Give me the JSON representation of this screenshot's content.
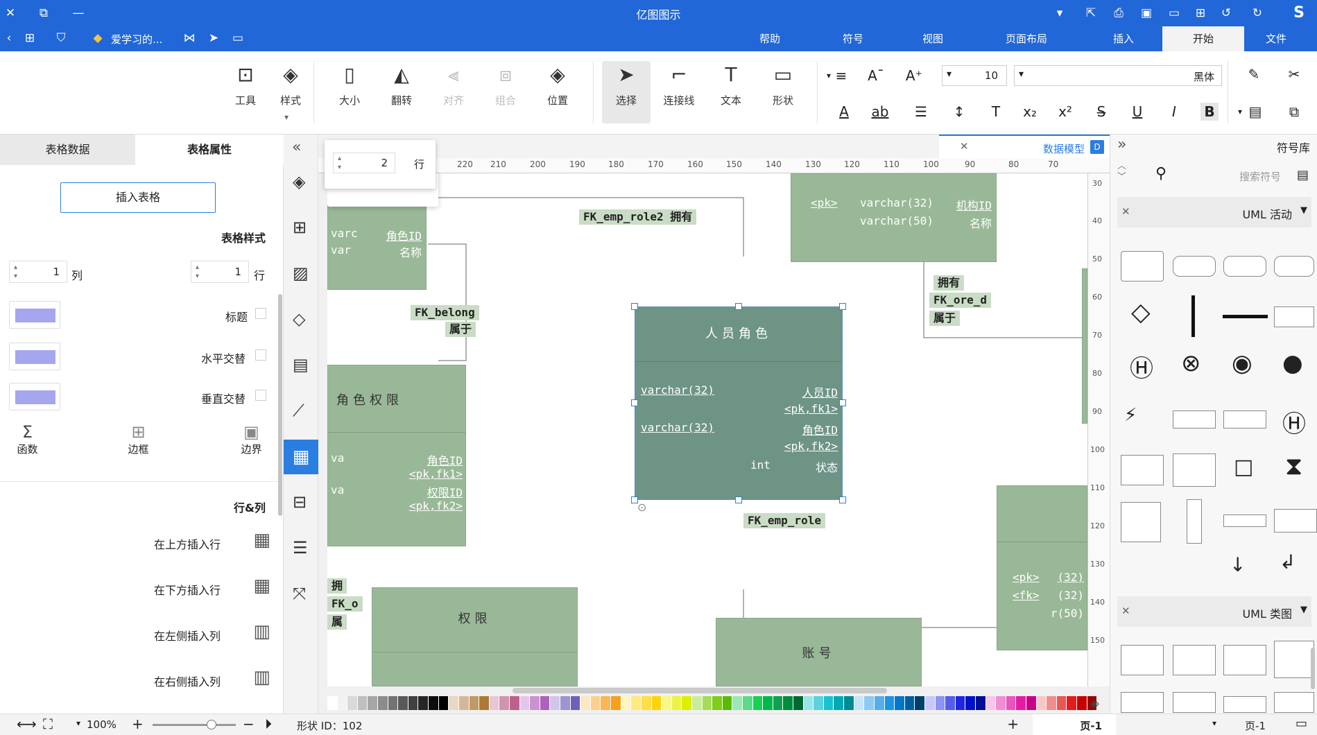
{
  "app": {
    "title": "亿图图示"
  },
  "menu_tabs": [
    "文件",
    "开始",
    "插入",
    "页面布局",
    "视图",
    "符号",
    "帮助"
  ],
  "quick": {
    "user": "爱学习的..."
  },
  "ribbon": {
    "font_name": "黑体",
    "font_size": "10",
    "tools": {
      "shape": "形状",
      "text": "文本",
      "connector": "连接线",
      "select": "选择",
      "position": "位置",
      "group": "组合",
      "align": "对齐",
      "rotate": "翻转",
      "size": "大小",
      "style": "样式",
      "tools": "工具"
    }
  },
  "left_panel": {
    "tabs": [
      "表格属性",
      "表格数据"
    ],
    "insert_table": "插入表格",
    "table_style_title": "表格样式",
    "row_label": "行",
    "row_value": "1",
    "col_label": "列",
    "col_value": "1",
    "checks": [
      "标题",
      "水平交替",
      "垂直交替"
    ],
    "borders": [
      "边界",
      "边框",
      "函数"
    ],
    "rows_cols_title": "行&列",
    "row_col_actions": [
      "在上方插入行",
      "在下方插入行",
      "在左侧插入列",
      "在右侧插入列"
    ]
  },
  "canvas": {
    "doc_tab": "数据模型",
    "float_row_label": "行",
    "float_row_value": "2",
    "ruler": [
      "220",
      "210",
      "200",
      "190",
      "180",
      "170",
      "160",
      "150",
      "140",
      "130",
      "120",
      "110",
      "100",
      "90",
      "80",
      "70"
    ],
    "vruler": [
      "30",
      "40",
      "50",
      "60",
      "70",
      "80",
      "90",
      "100",
      "110",
      "120",
      "130",
      "140",
      "150"
    ],
    "entities": {
      "center_title": "人员角色",
      "center_fields": [
        [
          "人员ID",
          "varchar(32)"
        ],
        [
          "<pk,fk1>",
          ""
        ],
        [
          "角色ID",
          "varchar(32)"
        ],
        [
          "<pk,fk2>",
          ""
        ],
        [
          "状态",
          "int"
        ]
      ],
      "org_fields": [
        [
          "机构ID",
          "varchar(32)",
          "<pk>"
        ],
        [
          "名称",
          "varchar(50)",
          ""
        ]
      ],
      "topleft_fields": [
        [
          "角色ID",
          "varc"
        ],
        [
          "名称",
          "var"
        ]
      ],
      "role_perm_title": "角色权限",
      "role_perm_fields": [
        [
          "角色ID",
          "va"
        ],
        [
          "<pk,fk1>",
          ""
        ],
        [
          "权限ID",
          "va"
        ],
        [
          "<pk,fk2>",
          ""
        ]
      ],
      "perm_title": "权限",
      "account_title": "账号",
      "right_fields": [
        [
          "(32)",
          "<pk>"
        ],
        [
          "(32)",
          "<fk>"
        ],
        [
          "r(50)",
          ""
        ]
      ]
    },
    "labels": {
      "fk_emp_role2": "FK_emp_role2",
      "own1": "拥有",
      "fk_belong": "FK_belong",
      "belong1": "属于",
      "own2": "拥有",
      "fk_ore_d": "FK_ore_d",
      "belong2": "属于",
      "fk_emp_role": "FK_emp_role",
      "own3": "拥",
      "fk_o": "FK_o",
      "belong3": "属"
    }
  },
  "right_panel": {
    "title": "符号库",
    "search_placeholder": "搜索符号",
    "sections": [
      "UML 活动",
      "UML 类图"
    ]
  },
  "status": {
    "page_tab": "页-1",
    "page_label": "页-1",
    "shape_id": "形状 ID：102",
    "zoom": "100%"
  }
}
